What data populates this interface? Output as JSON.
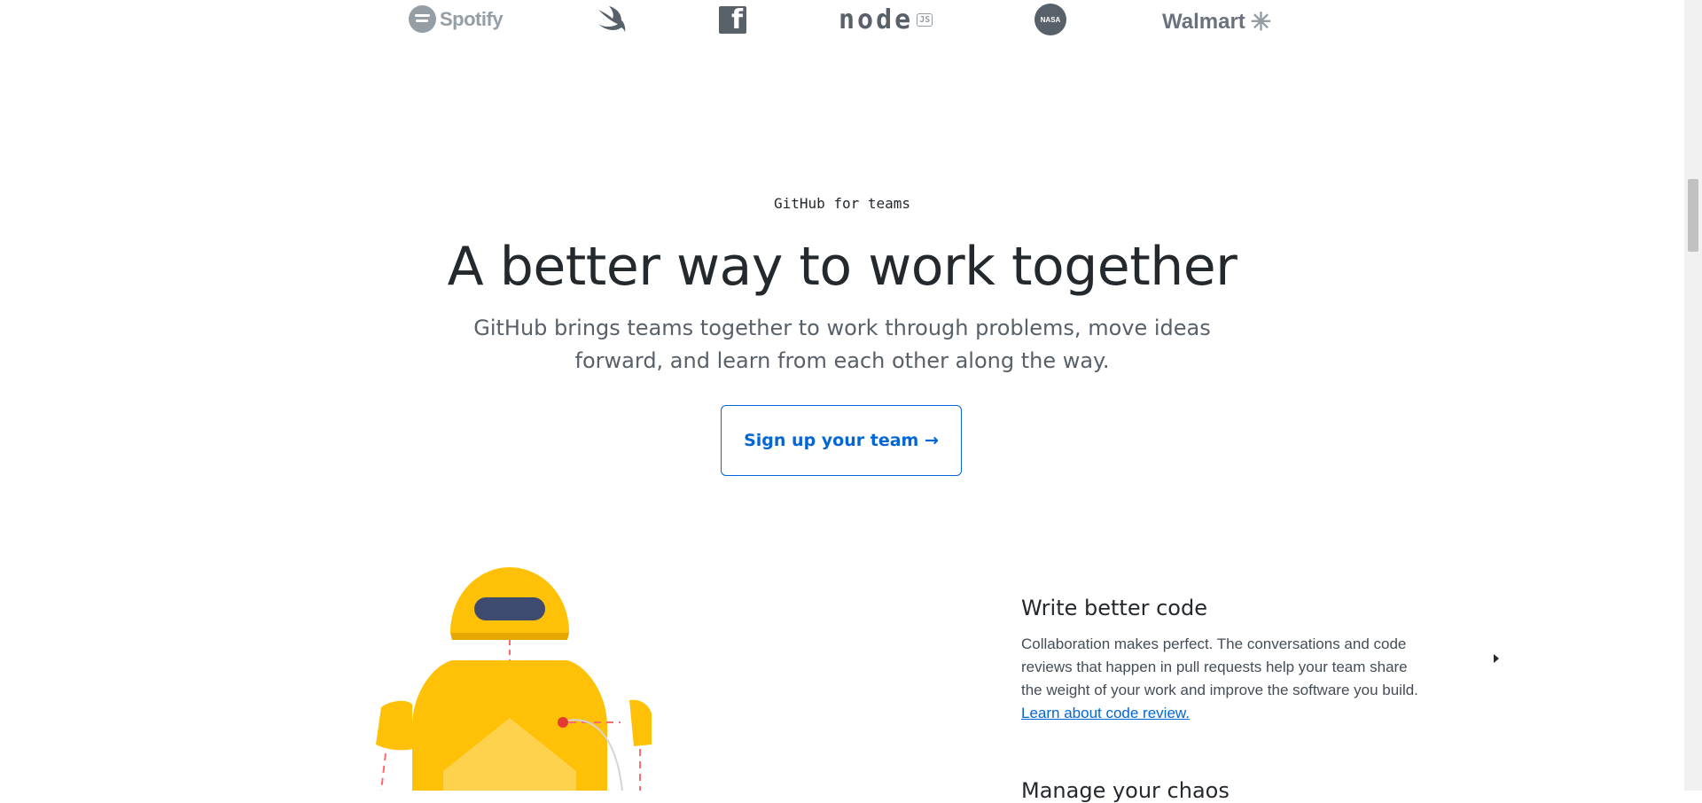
{
  "logos": [
    {
      "name": "Spotify",
      "icon": "spotify-logo"
    },
    {
      "name": "",
      "icon": "swift-logo"
    },
    {
      "name": "f",
      "icon": "facebook-logo"
    },
    {
      "name": "node",
      "icon": "nodejs-logo"
    },
    {
      "name": "NASA",
      "icon": "nasa-logo"
    },
    {
      "name": "Walmart",
      "icon": "walmart-logo"
    }
  ],
  "teams": {
    "eyebrow": "GitHub for teams",
    "headline": "A better way to work together",
    "subhead": "GitHub brings teams together to work through problems, move ideas forward, and learn from each other along the way.",
    "cta_label": "Sign up your team →"
  },
  "feature": {
    "title": "Write better code",
    "body": "Collaboration makes perfect. The conversations and code reviews that happen in pull requests help your team share the weight of your work and improve the software you build.",
    "link_label": "Learn about code review."
  },
  "next_feature": {
    "title": "Manage your chaos"
  },
  "colors": {
    "accent": "#0366d6",
    "robot_yellow": "#ffc107",
    "text": "#24292e"
  }
}
